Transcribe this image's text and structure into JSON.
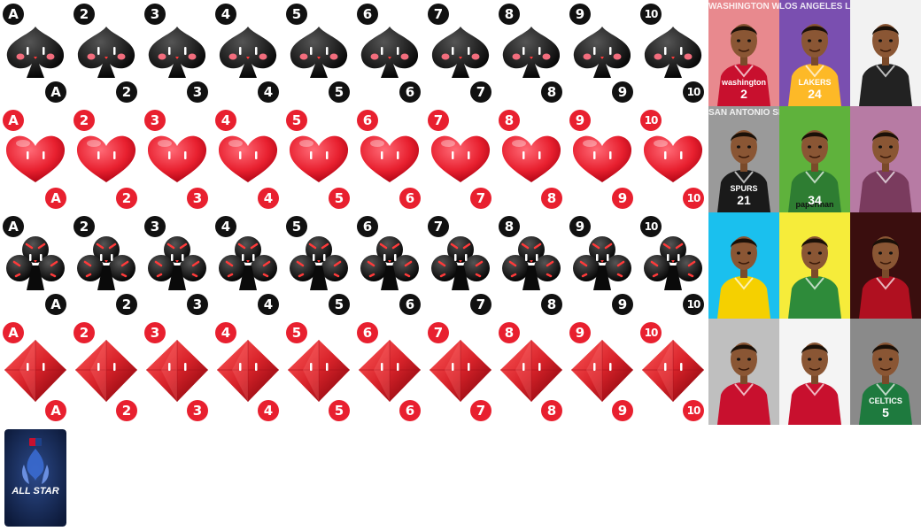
{
  "ranks": [
    "A",
    "2",
    "3",
    "4",
    "5",
    "6",
    "7",
    "8",
    "9",
    "10"
  ],
  "suits": [
    {
      "name": "spade",
      "icon": "spade-icon",
      "color": "#111111"
    },
    {
      "name": "heart",
      "icon": "heart-icon",
      "color": "#e8202f"
    },
    {
      "name": "club",
      "icon": "club-icon",
      "color": "#111111"
    },
    {
      "name": "diamond",
      "icon": "diamond-icon",
      "color": "#d8232a"
    }
  ],
  "colors": {
    "black_badge": "#111111",
    "red_badge": "#e8202f"
  },
  "players": [
    {
      "team_text": "WASHINGTON WIZARDS",
      "jersey_text": "washington",
      "number": "2",
      "bg": "#e8898e",
      "jersey": "#c8102e"
    },
    {
      "team_text": "LOS ANGELES LAKERS",
      "jersey_text": "LAKERS",
      "number": "24",
      "bg": "#7a4fb0",
      "jersey": "#fdb927"
    },
    {
      "team_text": "",
      "jersey_text": "",
      "number": "",
      "bg": "#f2f2f2",
      "jersey": "#222222"
    },
    {
      "team_text": "SAN ANTONIO SPURS",
      "jersey_text": "SPURS",
      "number": "21",
      "bg": "#9a9a9a",
      "jersey": "#1a1a1a"
    },
    {
      "team_text": "",
      "jersey_text": "paperman",
      "number": "34",
      "bg": "#5fb23c",
      "jersey": "#2e7d32"
    },
    {
      "team_text": "",
      "jersey_text": "",
      "number": "",
      "bg": "#b77ba4",
      "jersey": "#7a3b5e"
    },
    {
      "team_text": "",
      "jersey_text": "",
      "number": "",
      "bg": "#1ac0ee",
      "jersey": "#f5d000"
    },
    {
      "team_text": "",
      "jersey_text": "",
      "number": "",
      "bg": "#f6ec3a",
      "jersey": "#2e8b3a"
    },
    {
      "team_text": "",
      "jersey_text": "",
      "number": "",
      "bg": "#3a0e0e",
      "jersey": "#b01020"
    },
    {
      "team_text": "",
      "jersey_text": "",
      "number": "",
      "bg": "#bfbfbf",
      "jersey": "#c8102e"
    },
    {
      "team_text": "",
      "jersey_text": "",
      "number": "",
      "bg": "#f4f4f4",
      "jersey": "#c8102e"
    },
    {
      "team_text": "",
      "jersey_text": "CELTICS",
      "number": "5",
      "bg": "#8a8a8a",
      "jersey": "#1e7a3e"
    }
  ],
  "allstar": {
    "logo_text": "ALL STAR",
    "bg": "#0d1a3a"
  }
}
